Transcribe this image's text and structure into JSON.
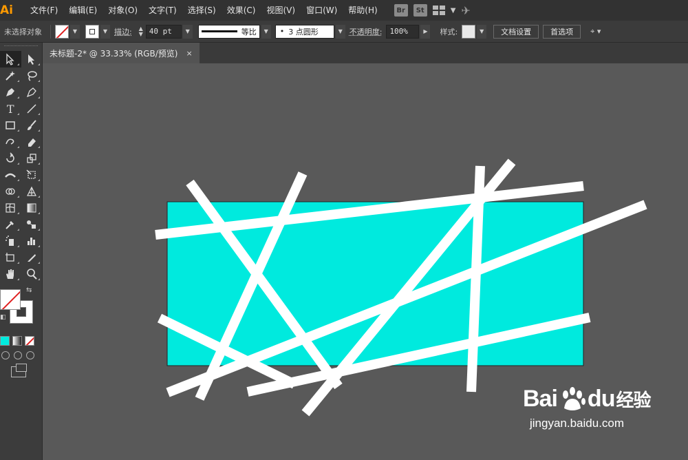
{
  "app": {
    "logo": "Ai"
  },
  "menu": [
    "文件(F)",
    "编辑(E)",
    "对象(O)",
    "文字(T)",
    "选择(S)",
    "效果(C)",
    "视图(V)",
    "窗口(W)",
    "帮助(H)"
  ],
  "menu_icons": {
    "bridge": "Br",
    "stock": "St"
  },
  "control": {
    "selection_status": "未选择对象",
    "stroke_label": "描边",
    "stroke_weight": "40 pt",
    "stroke_profile": "等比",
    "brush": "3 点圆形",
    "brush_dot": "•",
    "opacity_label": "不透明度",
    "opacity_value": "100%",
    "style_label": "样式",
    "doc_setup_btn": "文档设置",
    "prefs_btn": "首选项"
  },
  "document": {
    "tab_title": "未标题-2* @ 33.33% (RGB/预览)",
    "close_icon": "×"
  },
  "artwork": {
    "rect_fill": "#00eade",
    "stroke_color": "#ffffff",
    "background": "#595959"
  },
  "watermark": {
    "brand_latin": "Bai",
    "brand_latin2": "du",
    "brand_cn": "经验",
    "url": "jingyan.baidu.com"
  }
}
